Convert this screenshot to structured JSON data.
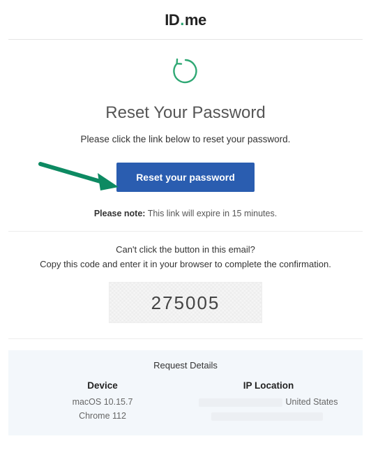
{
  "logo": {
    "part1": "ID",
    "dot": ".",
    "part2": "me"
  },
  "main": {
    "title": "Reset Your Password",
    "instruction": "Please click the link below to reset your password.",
    "button_label": "Reset your password",
    "note_label": "Please note:",
    "note_text": " This link will expire in 15 minutes."
  },
  "alt": {
    "question": "Can't click the button in this email?",
    "instruction": "Copy this code and enter it in your browser to complete the confirmation.",
    "code": "275005"
  },
  "details": {
    "title": "Request Details",
    "device_label": "Device",
    "device_os": "macOS 10.15.7",
    "device_browser": "Chrome 112",
    "ip_label": "IP Location",
    "ip_country": "United States"
  }
}
